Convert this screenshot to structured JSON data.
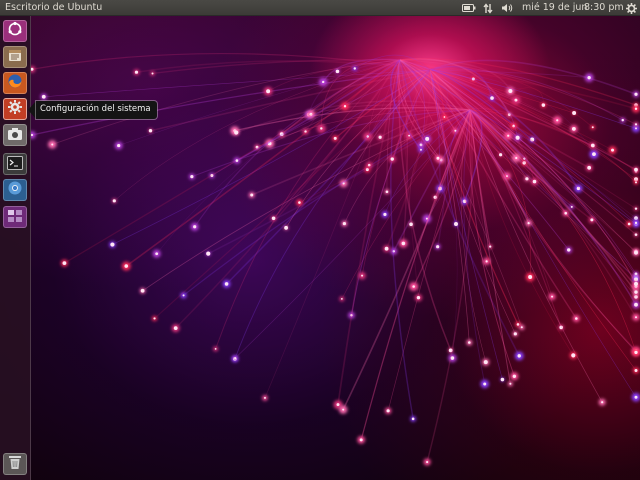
{
  "top_panel": {
    "window_title": "Escritorio de Ubuntu",
    "indicators": [
      {
        "name": "battery-icon"
      },
      {
        "name": "network-icon"
      },
      {
        "name": "volume-icon"
      }
    ],
    "date": "mié 19 de jun",
    "time": "8:30 pm",
    "session_icon": "gear-icon"
  },
  "launcher": {
    "items": [
      {
        "name": "dash-home-icon",
        "bg": "#9b2f7b"
      },
      {
        "name": "files-icon",
        "bg": "#8a6c4e"
      },
      {
        "name": "firefox-icon",
        "bg": "#c9581f"
      },
      {
        "name": "system-settings-icon",
        "bg": "#c23e25"
      },
      {
        "name": "screenshot-app-icon",
        "bg": "#6f6a69"
      },
      {
        "name": "terminal-icon",
        "bg": "#3b3b3b"
      },
      {
        "name": "chromium-icon",
        "bg": "#2c5f91"
      },
      {
        "name": "workspace-switcher-icon",
        "bg": "#6e2a78"
      }
    ],
    "trash": {
      "name": "trash-icon",
      "bg": "#5b5656"
    }
  },
  "tooltip": {
    "label": "Configuración del sistema"
  },
  "colors": {
    "panel": "#3c3b37",
    "accent": "#e8307d",
    "tooltip_bg": "#141414"
  }
}
